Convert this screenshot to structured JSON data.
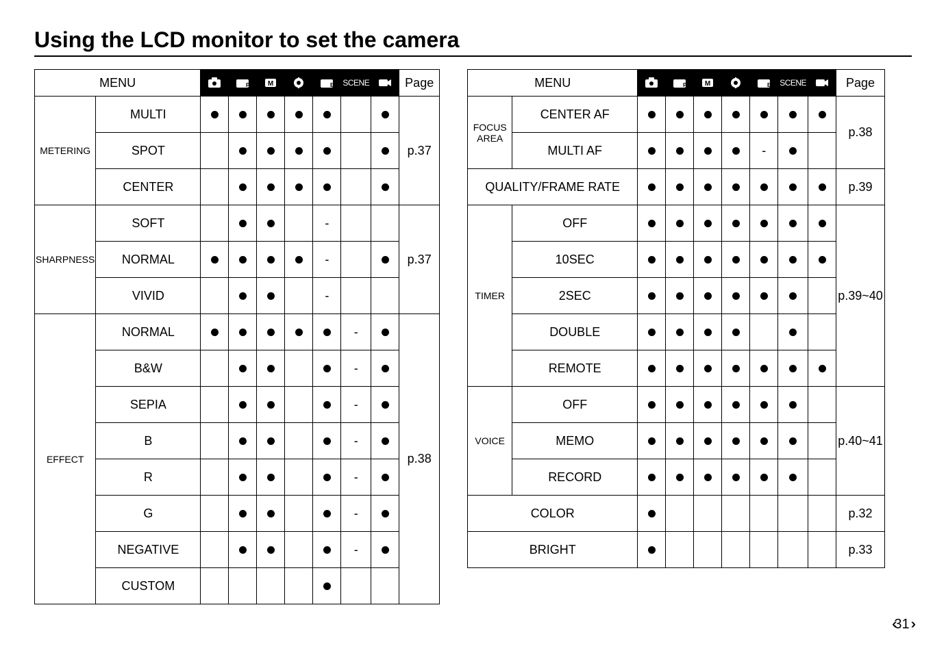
{
  "title": "Using the LCD monitor to set the camera",
  "headers": {
    "menu": "MENU",
    "page": "Page",
    "scene": "SCENE"
  },
  "leftTable": {
    "groups": [
      {
        "cat": "METERING",
        "page": "p.37",
        "rows": [
          {
            "label": "MULTI",
            "m": [
              "d",
              "d",
              "d",
              "d",
              "d",
              "",
              "d"
            ]
          },
          {
            "label": "SPOT",
            "m": [
              "",
              "d",
              "d",
              "d",
              "d",
              "",
              "d"
            ]
          },
          {
            "label": "CENTER",
            "m": [
              "",
              "d",
              "d",
              "d",
              "d",
              "",
              "d"
            ]
          }
        ]
      },
      {
        "cat": "SHARPNESS",
        "page": "p.37",
        "rows": [
          {
            "label": "SOFT",
            "m": [
              "",
              "d",
              "d",
              "",
              "-",
              "",
              ""
            ]
          },
          {
            "label": "NORMAL",
            "m": [
              "d",
              "d",
              "d",
              "d",
              "-",
              "",
              "d"
            ]
          },
          {
            "label": "VIVID",
            "m": [
              "",
              "d",
              "d",
              "",
              "-",
              "",
              ""
            ]
          }
        ]
      },
      {
        "cat": "EFFECT",
        "page": "p.38",
        "rows": [
          {
            "label": "NORMAL",
            "m": [
              "d",
              "d",
              "d",
              "d",
              "d",
              "-",
              "d"
            ]
          },
          {
            "label": "B&W",
            "m": [
              "",
              "d",
              "d",
              "",
              "d",
              "-",
              "d"
            ]
          },
          {
            "label": "SEPIA",
            "m": [
              "",
              "d",
              "d",
              "",
              "d",
              "-",
              "d"
            ]
          },
          {
            "label": "B",
            "m": [
              "",
              "d",
              "d",
              "",
              "d",
              "-",
              "d"
            ]
          },
          {
            "label": "R",
            "m": [
              "",
              "d",
              "d",
              "",
              "d",
              "-",
              "d"
            ]
          },
          {
            "label": "G",
            "m": [
              "",
              "d",
              "d",
              "",
              "d",
              "-",
              "d"
            ]
          },
          {
            "label": "NEGATIVE",
            "m": [
              "",
              "d",
              "d",
              "",
              "d",
              "-",
              "d"
            ]
          },
          {
            "label": "CUSTOM",
            "m": [
              "",
              "",
              "",
              "",
              "d",
              "",
              ""
            ]
          }
        ]
      }
    ]
  },
  "rightTable": {
    "groups": [
      {
        "cat": "FOCUS AREA",
        "page": "p.38",
        "rows": [
          {
            "label": "CENTER AF",
            "m": [
              "d",
              "d",
              "d",
              "d",
              "d",
              "d",
              "d"
            ]
          },
          {
            "label": "MULTI AF",
            "m": [
              "d",
              "d",
              "d",
              "d",
              "-",
              "d",
              ""
            ]
          }
        ]
      },
      {
        "cat": "QUALITY/FRAME RATE",
        "span": true,
        "page": "p.39",
        "rows": [
          {
            "label": "",
            "m": [
              "d",
              "d",
              "d",
              "d",
              "d",
              "d",
              "d"
            ]
          }
        ]
      },
      {
        "cat": "TIMER",
        "page": "p.39~40",
        "rows": [
          {
            "label": "OFF",
            "m": [
              "d",
              "d",
              "d",
              "d",
              "d",
              "d",
              "d"
            ]
          },
          {
            "label": "10SEC",
            "m": [
              "d",
              "d",
              "d",
              "d",
              "d",
              "d",
              "d"
            ]
          },
          {
            "label": "2SEC",
            "m": [
              "d",
              "d",
              "d",
              "d",
              "d",
              "d",
              ""
            ]
          },
          {
            "label": "DOUBLE",
            "m": [
              "d",
              "d",
              "d",
              "d",
              "",
              "d",
              ""
            ]
          },
          {
            "label": "REMOTE",
            "m": [
              "d",
              "d",
              "d",
              "d",
              "d",
              "d",
              "d"
            ]
          }
        ]
      },
      {
        "cat": "VOICE",
        "page": "p.40~41",
        "rows": [
          {
            "label": "OFF",
            "m": [
              "d",
              "d",
              "d",
              "d",
              "d",
              "d",
              ""
            ]
          },
          {
            "label": "MEMO",
            "m": [
              "d",
              "d",
              "d",
              "d",
              "d",
              "d",
              ""
            ]
          },
          {
            "label": "RECORD",
            "m": [
              "d",
              "d",
              "d",
              "d",
              "d",
              "d",
              ""
            ]
          }
        ]
      },
      {
        "cat": "COLOR",
        "span": true,
        "page": "p.32",
        "rows": [
          {
            "label": "",
            "m": [
              "d",
              "",
              "",
              "",
              "",
              "",
              ""
            ]
          }
        ]
      },
      {
        "cat": "BRIGHT",
        "span": true,
        "page": "p.33",
        "rows": [
          {
            "label": "",
            "m": [
              "d",
              "",
              "",
              "",
              "",
              "",
              ""
            ]
          }
        ]
      }
    ]
  },
  "pageNum": "31"
}
